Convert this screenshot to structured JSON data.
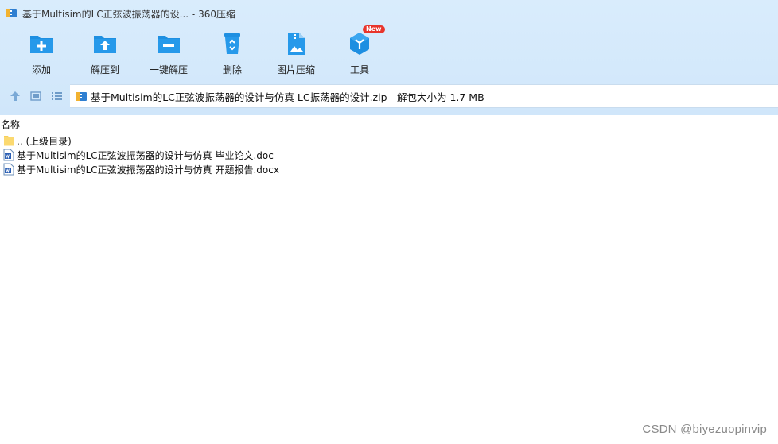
{
  "window": {
    "title": "基于Multisim的LC正弦波振荡器的设... - 360压缩"
  },
  "toolbar": {
    "items": [
      {
        "label": "添加",
        "icon": "add-folder-icon"
      },
      {
        "label": "解压到",
        "icon": "extract-to-icon"
      },
      {
        "label": "一键解压",
        "icon": "one-click-extract-icon"
      },
      {
        "label": "删除",
        "icon": "recycle-bin-icon"
      },
      {
        "label": "图片压缩",
        "icon": "image-compress-icon"
      },
      {
        "label": "工具",
        "icon": "tools-cube-icon",
        "badge": "New"
      }
    ]
  },
  "addressbar": {
    "path": "基于Multisim的LC正弦波振荡器的设计与仿真 LC振荡器的设计.zip - 解包大小为 1.7 MB"
  },
  "list": {
    "column_name": "名称",
    "rows": [
      {
        "name": ".. (上级目录)",
        "icon": "folder-icon"
      },
      {
        "name": "基于Multisim的LC正弦波振荡器的设计与仿真 毕业论文.doc",
        "icon": "word-doc-icon"
      },
      {
        "name": "基于Multisim的LC正弦波振荡器的设计与仿真 开题报告.docx",
        "icon": "word-doc-icon"
      }
    ]
  },
  "watermark": "CSDN @biyezuopinvip",
  "colors": {
    "chrome_bg": "#d4e9fb",
    "icon_blue": "#1e8fe1",
    "badge_red": "#e8352c"
  }
}
